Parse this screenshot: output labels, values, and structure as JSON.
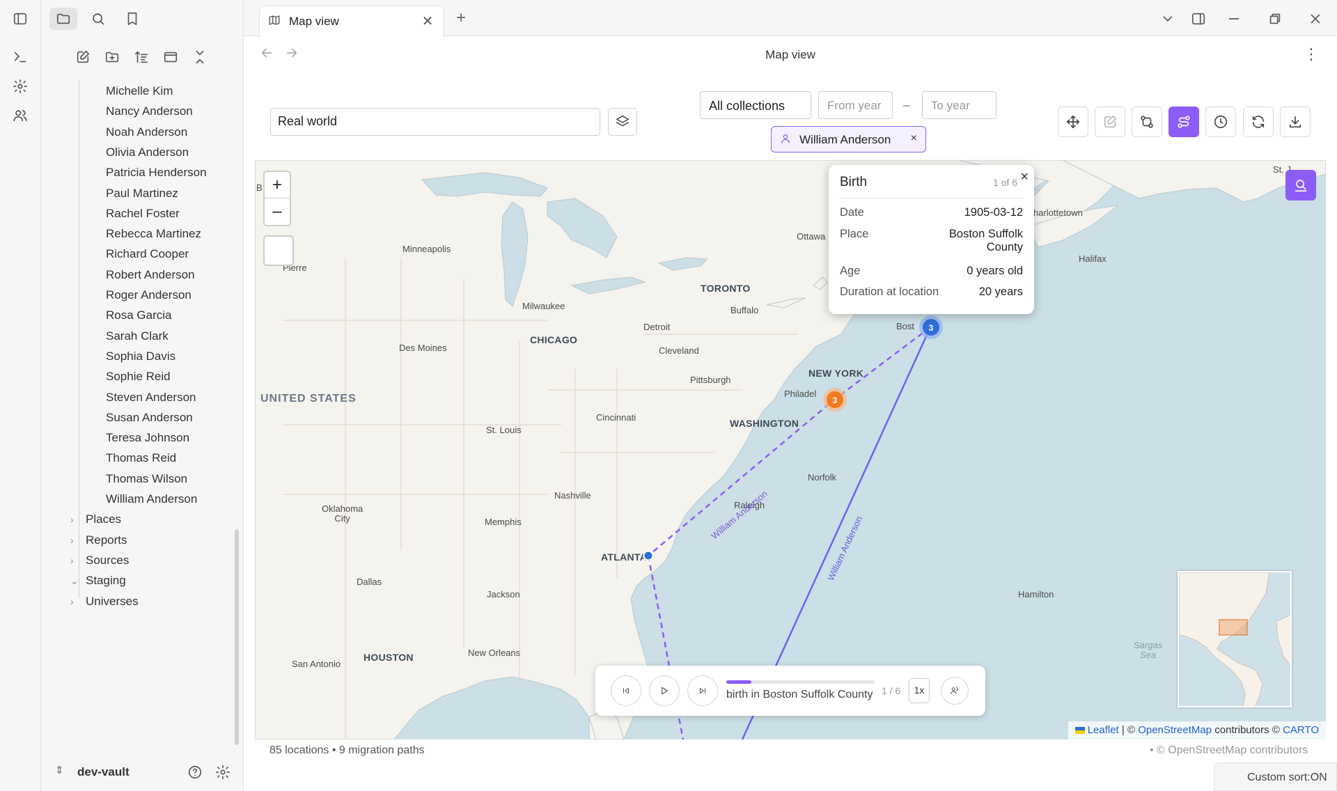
{
  "tab": {
    "title": "Map view"
  },
  "view": {
    "title": "Map view"
  },
  "sidebar": {
    "people": [
      "Michelle Kim",
      "Nancy Anderson",
      "Noah Anderson",
      "Olivia Anderson",
      "Patricia Henderson",
      "Paul Martinez",
      "Rachel Foster",
      "Rebecca Martinez",
      "Richard Cooper",
      "Robert Anderson",
      "Roger Anderson",
      "Rosa Garcia",
      "Sarah Clark",
      "Sophia Davis",
      "Sophie Reid",
      "Steven Anderson",
      "Susan Anderson",
      "Teresa Johnson",
      "Thomas Reid",
      "Thomas Wilson",
      "William Anderson"
    ],
    "folders": [
      "Places",
      "Reports",
      "Sources",
      "Staging",
      "Universes"
    ],
    "vault": "dev-vault"
  },
  "toolbar": {
    "map_type": "Real world",
    "collection": "All collections",
    "from_year_placeholder": "From year",
    "to_year_placeholder": "To year",
    "year_separator": "–",
    "person_filter": "William Anderson",
    "chip_remove": "×"
  },
  "popup": {
    "title": "Birth",
    "counter": "1 of 6",
    "close": "×",
    "rows": [
      {
        "key": "Date",
        "value": "1905-03-12"
      },
      {
        "key": "Place",
        "value": "Boston Suffolk County"
      },
      {
        "key": "Age",
        "value": "0 years old"
      },
      {
        "key": "Duration at location",
        "value": "20 years"
      }
    ]
  },
  "map": {
    "zoom_in": "+",
    "zoom_out": "–",
    "cluster_boston": "3",
    "cluster_philadelphia": "3",
    "path_label_a": "William Anderson",
    "path_label_b": "William Anderson",
    "cities": {
      "minneapolis": "Minneapolis",
      "pierre": "Pierre",
      "milwaukee": "Milwaukee",
      "toronto": "TORONTO",
      "ottawa": "Ottawa",
      "buffalo": "Buffalo",
      "detroit": "Detroit",
      "chicago": "CHICAGO",
      "desmoines": "Des Moines",
      "cleveland": "Cleveland",
      "pittsburgh": "Pittsburgh",
      "newyork": "NEW YORK",
      "philadelphia": "Philadel",
      "washington": "WASHINGTON",
      "boston": "Bost",
      "cincinnati": "Cincinnati",
      "stlouis": "St. Louis",
      "unitedstates": "UNITED STATES",
      "norfolk": "Norfolk",
      "nashville": "Nashville",
      "raleigh": "Raleigh",
      "oklahoma": "Oklahoma\nCity",
      "memphis": "Memphis",
      "atlanta": "ATLANTA",
      "dallas": "Dallas",
      "jackson": "Jackson",
      "houston": "HOUSTON",
      "neworleans": "New Orleans",
      "sanantonio": "San Antonio",
      "hamilton": "Hamilton",
      "halifax": "Halifax",
      "charlottetown": "harlottetown",
      "stjohns": "St. J",
      "bismarck": "B     ck",
      "sargasso": "Sargas\nSea"
    },
    "attribution": {
      "leaflet": "Leaflet",
      "sep": " | © ",
      "osm": "OpenStreetMap",
      "mid": " contributors © ",
      "carto": "CARTO"
    }
  },
  "player": {
    "caption": "birth in Boston Suffolk County",
    "step": "1 / 6",
    "speed": "1x",
    "progress": 0.1667
  },
  "status": {
    "left": "85 locations • 9 migration paths",
    "right": "• © OpenStreetMap contributors",
    "sort": "Custom sort:ON"
  },
  "colors": {
    "accent": "#8b5cf6",
    "path_solid": "#6366f1",
    "path_dashed": "#8b5cf6",
    "cluster_blue": "#2f6fdc",
    "cluster_orange": "#f07a1e",
    "water": "#ccdfe6",
    "land": "#f5f3ee"
  }
}
